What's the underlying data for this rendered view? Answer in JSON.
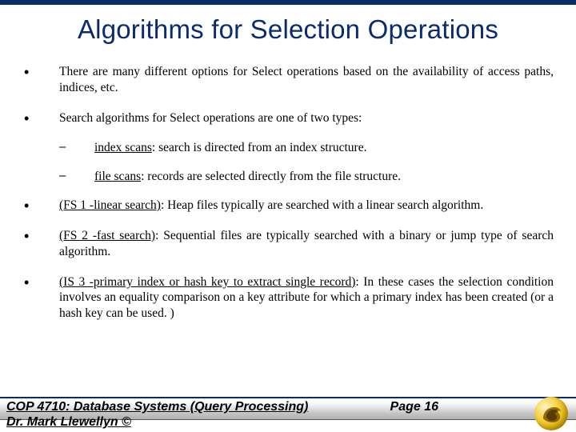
{
  "title": "Algorithms for Selection Operations",
  "bullets": {
    "b1": "There are many different options for Select operations based on the availability of access paths, indices, etc.",
    "b2": "Search algorithms for Select operations are one of two types:",
    "b2a_term": "index scans",
    "b2a_rest": ": search is directed from an index structure.",
    "b2b_term": "file scans",
    "b2b_rest": ": records are selected directly from the file structure.",
    "b3_term": "(FS 1 -linear search)",
    "b3_rest": ": Heap files typically are searched with a linear search algorithm.",
    "b4_term": "(FS 2 -fast search)",
    "b4_rest": ": Sequential files are typically searched with a binary or jump type of search algorithm.",
    "b5_term": "(IS 3 -primary index or hash key to extract single record)",
    "b5_rest": ": In these cases the selection condition involves an equality comparison on a key attribute for which a primary index has been created (or a hash key can be used. )"
  },
  "footer": {
    "course": "COP 4710: Database Systems (Query Processing)",
    "page": "Page 16",
    "author": "Dr. Mark Llewellyn ©"
  },
  "glyphs": {
    "bullet": "•",
    "dash": "–"
  }
}
